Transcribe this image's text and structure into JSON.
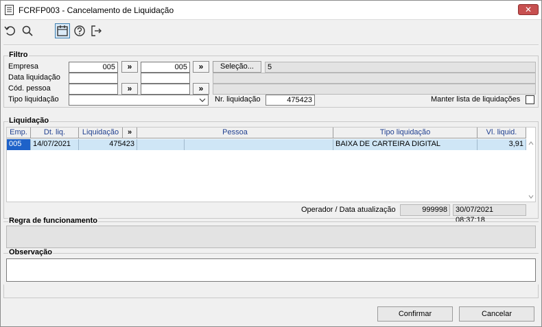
{
  "window": {
    "title": "FCRFP003 - Cancelamento de Liquidação",
    "close_symbol": "✕"
  },
  "toolbar": {
    "icons": [
      "undo-icon",
      "search-icon",
      "calendar-icon",
      "help-icon",
      "exit-icon"
    ]
  },
  "filtro": {
    "title": "Filtro",
    "empresa_label": "Empresa",
    "empresa_from": "005",
    "empresa_to": "005",
    "selecao_button": "Seleção...",
    "selecao_value": "5",
    "data_liquidacao_label": "Data liquidação",
    "data_from": "",
    "data_to": "",
    "cod_pessoa_label": "Cód. pessoa",
    "pessoa_from": "",
    "pessoa_to": "",
    "tipo_liquidacao_label": "Tipo liquidação",
    "tipo_liquidacao_value": "",
    "nr_liquidacao_label": "Nr. liquidação",
    "nr_liquidacao_value": "475423",
    "manter_lista_label": "Manter lista de liquidações",
    "manter_lista_checked": false,
    "expand_symbol": "»"
  },
  "liquidacao": {
    "title": "Liquidação",
    "columns": [
      "Emp.",
      "Dt. liq.",
      "Liquidação",
      "»",
      "Pessoa",
      "Tipo liquidação",
      "Vl. liquid."
    ],
    "rows": [
      {
        "emp": "005",
        "dt_liq": "14/07/2021",
        "liquidacao": "475423",
        "extra": "",
        "pessoa": "",
        "tipo": "BAIXA DE CARTEIRA DIGITAL",
        "valor": "3,91"
      }
    ],
    "operador_label": "Operador / Data atualização",
    "operador_value": "999998",
    "data_atualizacao": "30/07/2021 08:37:18"
  },
  "regra": {
    "title": "Regra de funcionamento",
    "text": ""
  },
  "observacao": {
    "title": "Observação",
    "text": ""
  },
  "footer": {
    "confirmar_label": "Confirmar",
    "cancelar_label": "Cancelar"
  }
}
